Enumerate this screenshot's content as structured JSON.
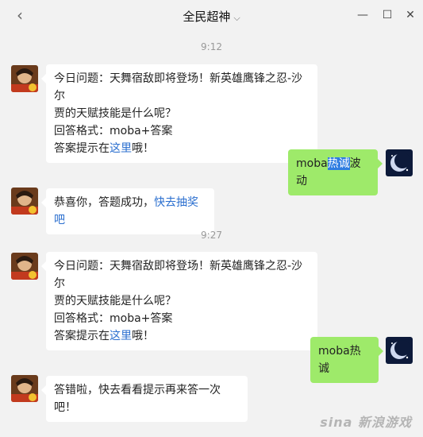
{
  "window": {
    "title": "全民超神",
    "back_glyph": "‹",
    "chevron_glyph": "⌵",
    "minimize_glyph": "—",
    "maximize_glyph": "☐",
    "close_glyph": "✕"
  },
  "messages": [
    {
      "type": "time",
      "text": "9:12"
    },
    {
      "type": "bot",
      "lines": [
        "今日问题：天舞宿敌即将登场！新英雄鹰锋之忍-沙尔",
        "贾的天赋技能是什么呢？",
        "回答格式：moba+答案"
      ],
      "hint_prefix": "答案提示在",
      "hint_link": "这里",
      "hint_suffix": "哦！"
    },
    {
      "type": "user",
      "pre": "moba",
      "selected": "热诚",
      "post": "波动"
    },
    {
      "type": "bot_short",
      "prefix": "恭喜你，答题成功，",
      "link": "快去抽奖吧"
    },
    {
      "type": "time",
      "text": "9:27"
    },
    {
      "type": "bot",
      "lines": [
        "今日问题：天舞宿敌即将登场！新英雄鹰锋之忍-沙尔",
        "贾的天赋技能是什么呢？",
        "回答格式：moba+答案"
      ],
      "hint_prefix": "答案提示在",
      "hint_link": "这里",
      "hint_suffix": "哦！"
    },
    {
      "type": "user",
      "text": "moba热诚"
    },
    {
      "type": "bot_plain",
      "text": "答错啦，快去看看提示再来答一次吧！"
    }
  ],
  "watermark": "sina 新浪游戏",
  "colors": {
    "link": "#2b6fcf",
    "user_bubble": "#9eea6a",
    "background": "#f2f2f2"
  }
}
